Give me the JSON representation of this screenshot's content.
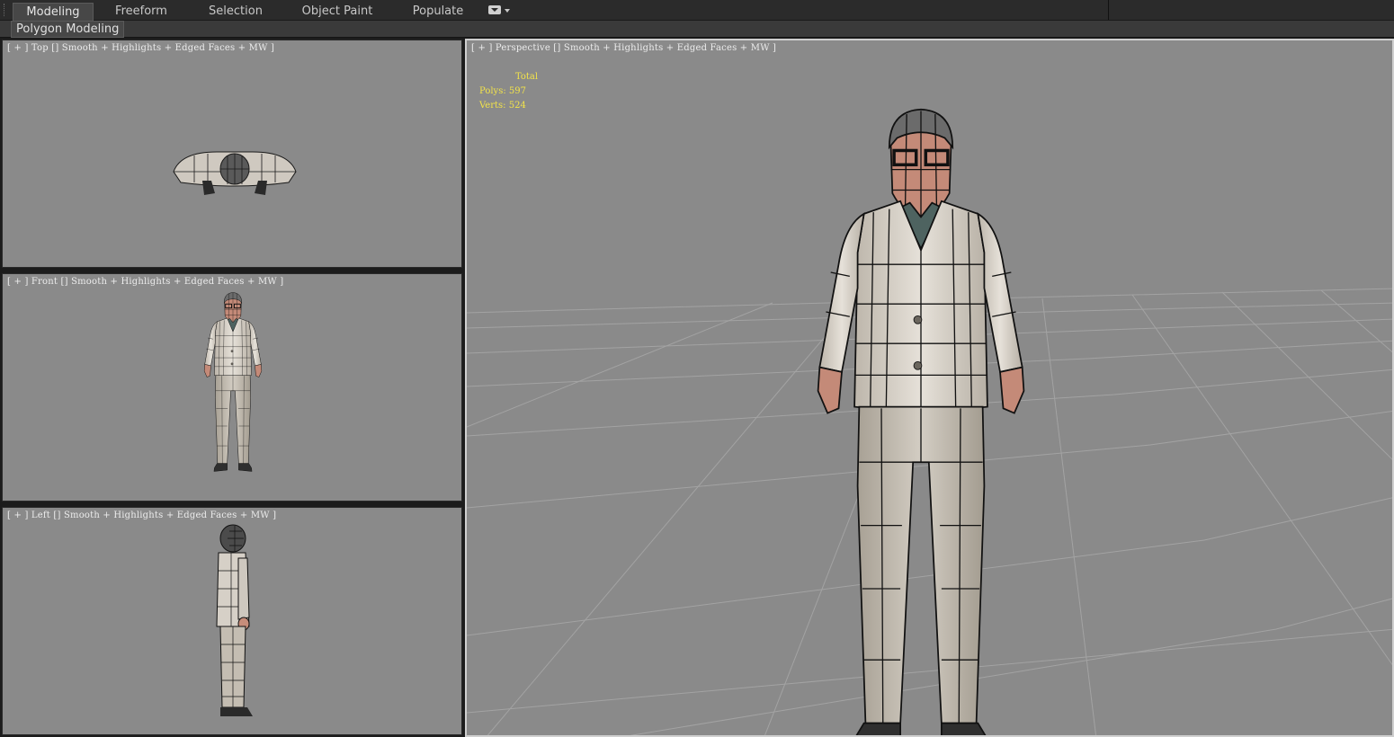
{
  "ribbon": {
    "tabs": [
      "Modeling",
      "Freeform",
      "Selection",
      "Object Paint",
      "Populate"
    ],
    "active_tab": "Modeling",
    "panel_label": "Polygon Modeling"
  },
  "viewports": {
    "top": {
      "label": "[ + ] Top [] Smooth + Highlights + Edged Faces + MW ]"
    },
    "front": {
      "label": "[ + ] Front [] Smooth + Highlights + Edged Faces + MW ]"
    },
    "left": {
      "label": "[ + ] Left [] Smooth + Highlights + Edged Faces + MW ]"
    },
    "perspective": {
      "label": "[ + ] Perspective [] Smooth + Highlights + Edged Faces + MW ]"
    }
  },
  "stats": {
    "header": "Total",
    "polys_label": "Polys:",
    "polys_value": "597",
    "verts_label": "Verts:",
    "verts_value": "524"
  },
  "colors": {
    "viewport_bg": "#8a8a8a",
    "stats_text": "#f2e34a",
    "suit": "#d8d2ca",
    "wire": "#1a1a1a"
  }
}
